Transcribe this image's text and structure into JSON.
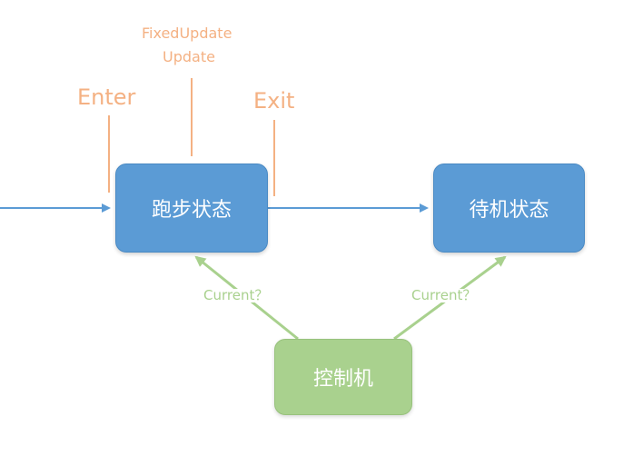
{
  "nodes": {
    "run_state": "跑步状态",
    "idle_state": "待机状态",
    "controller": "控制机"
  },
  "lifecycle": {
    "enter": "Enter",
    "exit": "Exit",
    "fixed_update": "FixedUpdate",
    "update": "Update"
  },
  "queries": {
    "left": "Current？",
    "right": "Current？"
  },
  "colors": {
    "state_fill": "#5b9bd5",
    "controller_fill": "#a9d18e",
    "transition_line": "#5b9bd5",
    "lifecycle_text": "#f4b183",
    "query_line": "#a9d18e"
  }
}
